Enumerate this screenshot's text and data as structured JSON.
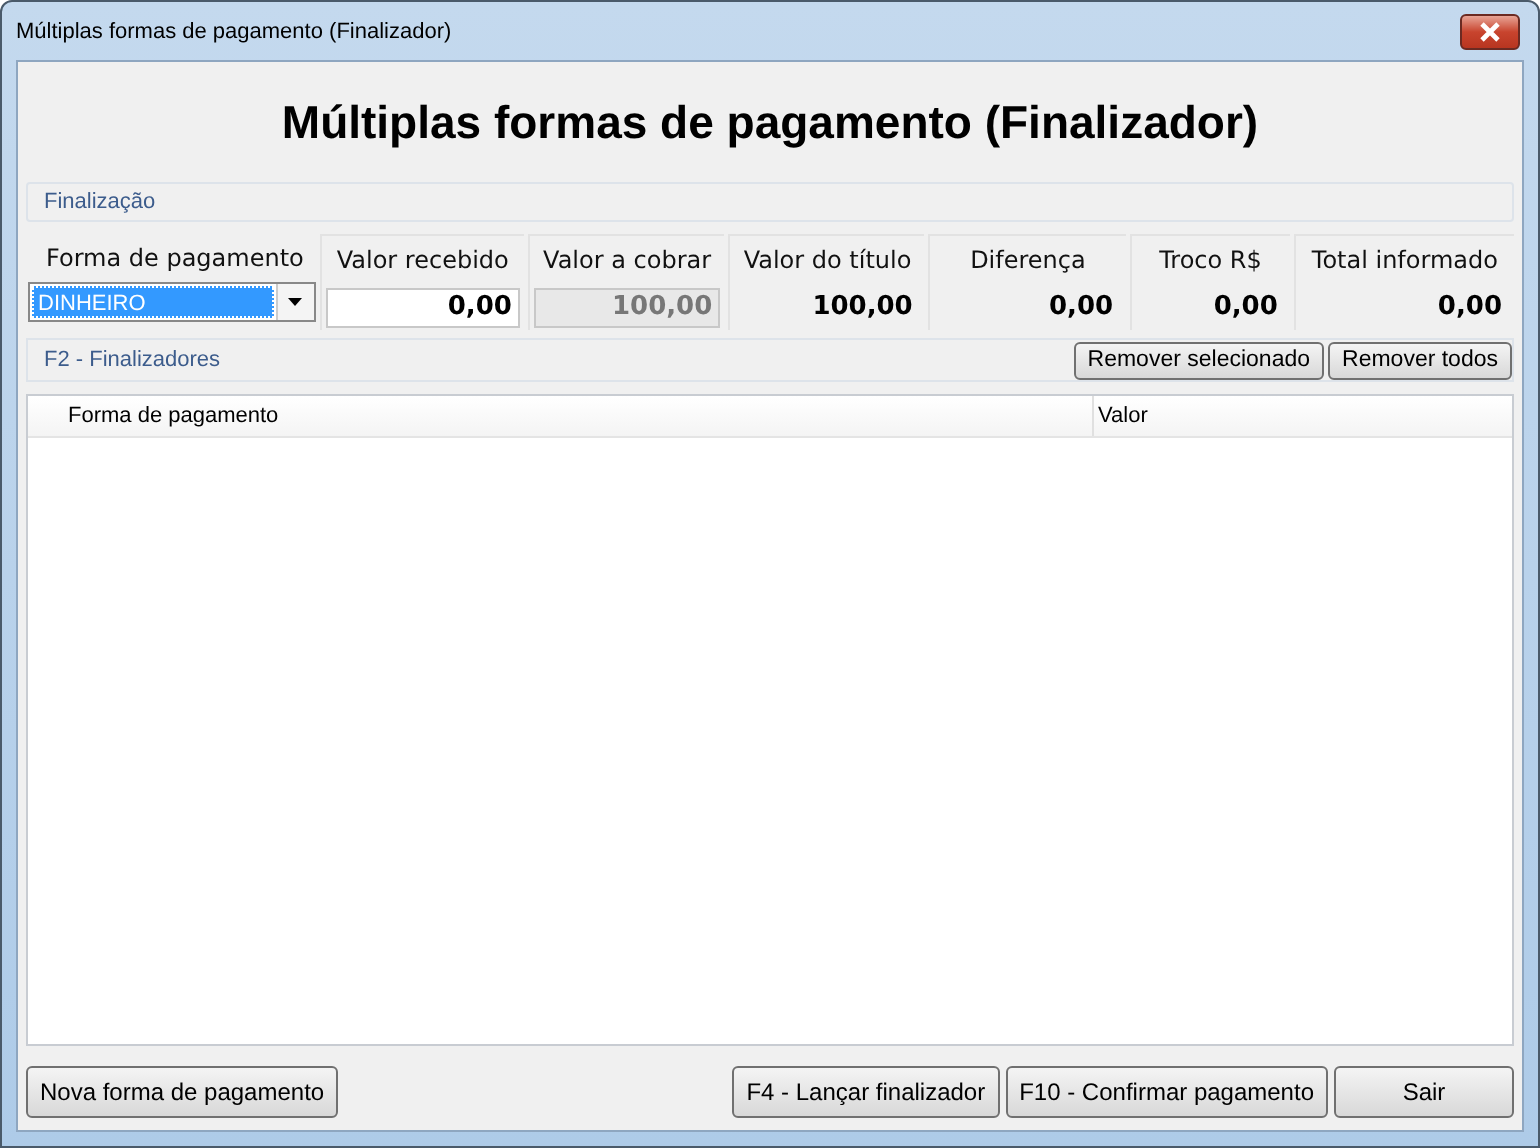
{
  "window": {
    "title": "Múltiplas formas de pagamento (Finalizador)"
  },
  "header": {
    "title": "Múltiplas formas de pagamento (Finalizador)"
  },
  "finalizacao": {
    "title": "Finalização",
    "fields": [
      {
        "kind": "combo",
        "label": "Forma de pagamento",
        "value": "DINHEIRO"
      },
      {
        "kind": "input",
        "label": "Valor recebido",
        "value": "0,00"
      },
      {
        "kind": "readonly",
        "label": "Valor a cobrar",
        "value": "100,00"
      },
      {
        "kind": "display",
        "label": "Valor do título",
        "value": "100,00"
      },
      {
        "kind": "display",
        "label": "Diferença",
        "value": "0,00"
      },
      {
        "kind": "display",
        "label": "Troco R$",
        "value": "0,00"
      },
      {
        "kind": "display",
        "label": "Total informado",
        "value": "0,00"
      }
    ]
  },
  "finalizadores": {
    "title": "F2 - Finalizadores",
    "buttons": [
      "Remover selecionado",
      "Remover todos"
    ]
  },
  "table": {
    "columns": [
      "Forma de pagamento",
      "Valor"
    ]
  },
  "footer": {
    "left_buttons": [
      "Nova forma de pagamento"
    ],
    "right_buttons": [
      "F4 - Lançar finalizador",
      "F10 - Confirmar pagamento",
      "Sair"
    ]
  }
}
